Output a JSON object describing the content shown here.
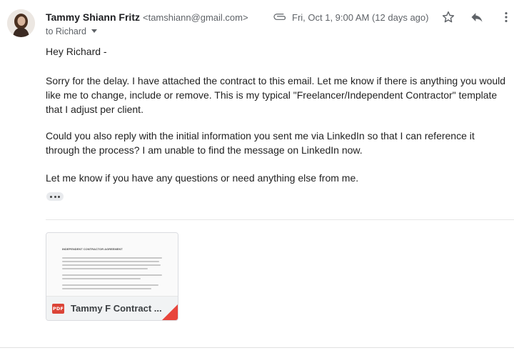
{
  "sender": {
    "name": "Tammy Shiann Fritz",
    "email": "<tamshiann@gmail.com>",
    "recipient_line": "to Richard"
  },
  "meta": {
    "date": "Fri, Oct 1, 9:00 AM (12 days ago)"
  },
  "icons": {
    "attachment": "paperclip-icon",
    "star": "star-icon",
    "reply": "reply-icon",
    "more": "more-vert-icon",
    "recipient_menu": "chevron-down-icon",
    "show_trimmed": "ellipsis-icon",
    "file_type": "pdf-icon"
  },
  "body": {
    "greeting": "Hey Richard -",
    "paragraph1": "Sorry for the delay. I have attached the contract to this email. Let me know if there is anything you would like me to change, include or remove. This is my typical \"Freelancer/Independent Contractor\" template that I adjust per client.",
    "paragraph2": "Could you also reply with the initial information you sent me via LinkedIn so that I can reference it through the process? I am unable to find the message on LinkedIn now.",
    "paragraph3": "Let me know if you have any questions or need anything else from me."
  },
  "attachment": {
    "file_type_label": "PDF",
    "name": "Tammy F Contract ...",
    "preview_title": "INDEPENDENT CONTRACTOR AGREEMENT"
  },
  "colors": {
    "pdf_red": "#db4437",
    "text": "#202124",
    "secondary": "#5f6368"
  }
}
